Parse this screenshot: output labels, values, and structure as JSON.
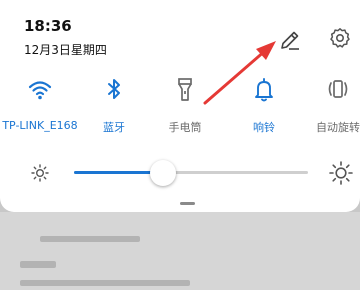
{
  "status": {
    "time": "18:36",
    "date": "12月3日星期四"
  },
  "header": {
    "edit_icon": "pencil-icon",
    "settings_icon": "gear-icon"
  },
  "tiles": [
    {
      "label": "TP-LINK_E168",
      "icon": "wifi-icon",
      "active": true
    },
    {
      "label": "蓝牙",
      "icon": "bluetooth-icon",
      "active": true
    },
    {
      "label": "手电筒",
      "icon": "flashlight-icon",
      "active": false
    },
    {
      "label": "响铃",
      "icon": "bell-icon",
      "active": true
    },
    {
      "label": "自动旋转",
      "icon": "auto-rotate-icon",
      "active": false
    }
  ],
  "brightness": {
    "level": 0.38
  },
  "colors": {
    "accent": "#1a75d2",
    "annotation_arrow": "#e53935",
    "inactive_icon": "#6a6a6a"
  }
}
